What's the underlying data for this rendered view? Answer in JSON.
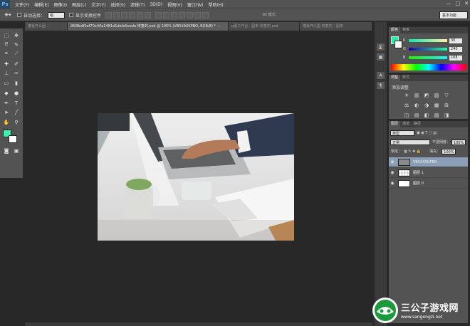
{
  "app": {
    "logo": "Ps"
  },
  "menu": [
    "文件(F)",
    "编辑(E)",
    "图像(I)",
    "图层(L)",
    "文字(Y)",
    "选择(S)",
    "滤镜(T)",
    "3D(D)",
    "视图(V)",
    "窗口(W)",
    "帮助(H)"
  ],
  "window_controls": [
    "—",
    "□",
    "✕"
  ],
  "options_bar": {
    "auto_select_label": "自动选择：",
    "auto_select_value": "组",
    "show_transform_label": "显示变换控件",
    "mode_3d_label": "3D 模式：",
    "workspace": "基本功能"
  },
  "document_tabs": [
    {
      "label": "模板开头图...",
      "active": false
    },
    {
      "label": "95f8bdf2ef70e40a1481d1defa5eeda-恢复的.psd @ 100% (VB5XASKPBO, RGB/8) *",
      "active": true
    },
    {
      "label": "p图工作台 - 副本-恢复的.psd",
      "active": false
    },
    {
      "label": "模板开头图-恢复的 - 副本",
      "active": false
    }
  ],
  "color_panel": {
    "tabs": [
      "颜色",
      "色板"
    ],
    "r_label": "R",
    "r_value": "30",
    "g_label": "G",
    "g_value": "240",
    "b_label": "B",
    "b_value": "168",
    "fg_color": "#1ef0a8",
    "bg_color": "#ffffff"
  },
  "adjustments_panel": {
    "tabs": [
      "调整",
      "样式"
    ],
    "title": "添加调整",
    "icons": [
      "☀",
      "▥",
      "◩",
      "▨",
      "▽",
      "⚖",
      "◐",
      "◑",
      "▦",
      "⊞",
      "◫",
      "▤",
      "◧",
      "▧",
      "◨"
    ]
  },
  "layers_panel": {
    "tabs": [
      "图层",
      "通道",
      "路径"
    ],
    "kind_label": "类型",
    "blend_mode": "正常",
    "opacity_label": "不透明度：",
    "opacity_value": "100%",
    "lock_label": "锁定：",
    "fill_label": "填充：",
    "fill_value": "100%",
    "layers": [
      {
        "name": "VB5XASKPBO",
        "selected": true,
        "thumb": "photo"
      },
      {
        "name": "图层 1",
        "selected": false,
        "thumb": "transparent"
      },
      {
        "name": "图层 0",
        "selected": false,
        "thumb": "white"
      }
    ]
  },
  "watermark": {
    "title": "三公子游戏网",
    "url": "www.sangongzi.net"
  }
}
